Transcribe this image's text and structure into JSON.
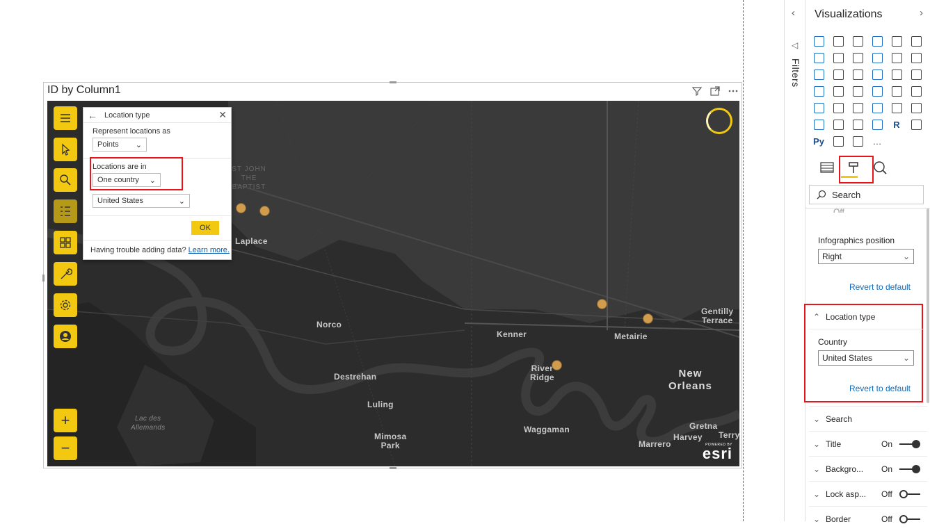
{
  "visual": {
    "title": "ID by Column1"
  },
  "map": {
    "toolbar": [
      "menu-icon",
      "select-icon",
      "search-icon",
      "layers-icon",
      "analysis-icon",
      "wrench-icon",
      "gear-icon",
      "user-icon"
    ],
    "zoom": [
      "+",
      "−"
    ],
    "labels": {
      "laplace": "Laplace",
      "norco": "Norco",
      "kenner": "Kenner",
      "metairie": "Metairie",
      "gentilly": "Gentilly\nTerrace",
      "new_orleans": "New\nOrleans",
      "destrehan": "Destrehan",
      "river_ridge": "River\nRidge",
      "luling": "Luling",
      "lac_des": "Lac des\nAllemands",
      "mimosa": "Mimosa\nPark",
      "waggaman": "Waggaman",
      "marrero": "Marrero",
      "gretna": "Gretna",
      "harvey": "Harvey",
      "terry": "Terry",
      "st_john": "ST JOHN\nTHE\nBAPTIST"
    },
    "esri": {
      "powered": "POWERED BY",
      "name": "esri"
    }
  },
  "popup": {
    "title": "Location type",
    "represent_label": "Represent locations as",
    "represent_value": "Points",
    "locations_label": "Locations are in",
    "locations_value": "One country",
    "country_value": "United States",
    "ok": "OK",
    "trouble": "Having trouble adding data?",
    "learn_more": "Learn more."
  },
  "filters": {
    "label": "Filters"
  },
  "viz": {
    "title": "Visualizations",
    "extra_icons": [
      "R",
      "Py",
      "…"
    ],
    "search_placeholder": "Search",
    "off_partial": "Off",
    "infographics_label": "Infographics position",
    "infographics_value": "Right",
    "revert": "Revert to default",
    "location_type": "Location type",
    "country_label": "Country",
    "country_value": "United States",
    "revert2": "Revert to default",
    "sections": [
      {
        "name": "Search",
        "state": ""
      },
      {
        "name": "Title",
        "state": "On"
      },
      {
        "name": "Backgro...",
        "state": "On"
      },
      {
        "name": "Lock asp...",
        "state": "Off"
      },
      {
        "name": "Border",
        "state": "Off"
      }
    ]
  }
}
